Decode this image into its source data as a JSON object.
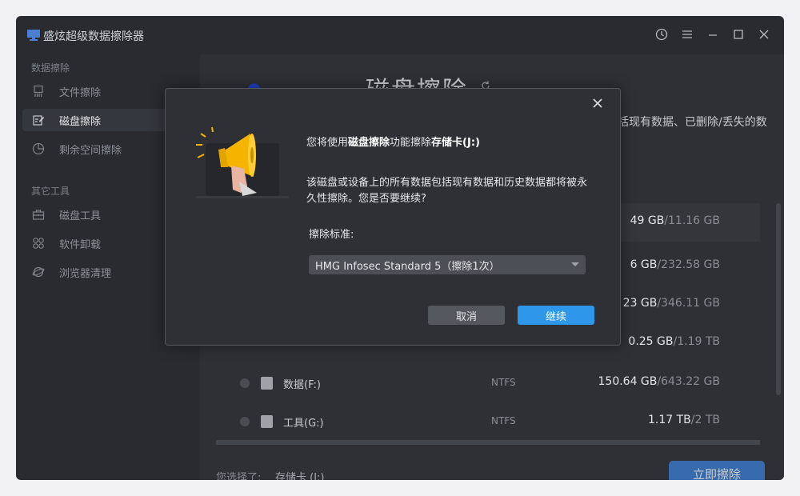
{
  "app": {
    "title": "盛炫超级数据擦除器"
  },
  "sidebar": {
    "section1": "数据擦除",
    "items1": [
      {
        "label": "文件擦除",
        "icon": "file-shred-icon"
      },
      {
        "label": "磁盘擦除",
        "icon": "disk-edit-icon",
        "active": true
      },
      {
        "label": "剩余空间擦除",
        "icon": "pie-chart-icon"
      }
    ],
    "section2": "其它工具",
    "items2": [
      {
        "label": "磁盘工具",
        "icon": "toolbox-icon"
      },
      {
        "label": "软件卸载",
        "icon": "apps-grid-icon"
      },
      {
        "label": "浏览器清理",
        "icon": "browser-icon"
      }
    ]
  },
  "main": {
    "heading": "磁盘擦除",
    "description": "括现有数据、已删除/丢失的数",
    "drives": [
      {
        "name": "",
        "fs": "",
        "used": "49 GB",
        "total": "/11.16 GB",
        "highlight": true
      },
      {
        "name": "",
        "fs": "",
        "used": "6 GB",
        "total": "/232.58 GB"
      },
      {
        "name": "",
        "fs": "",
        "used": "23 GB",
        "total": "/346.11 GB"
      },
      {
        "name": "",
        "fs": "",
        "used": "0.25 GB",
        "total": "/1.19 TB"
      },
      {
        "name": "数据(F:)",
        "fs": "NTFS",
        "used": "150.64 GB",
        "total": "/643.22 GB"
      },
      {
        "name": "工具(G:)",
        "fs": "NTFS",
        "used": "1.17 TB",
        "total": "/2 TB"
      }
    ],
    "footer_label": "您选择了:",
    "footer_value": "存储卡 (J:)",
    "erase_button": "立即擦除"
  },
  "dialog": {
    "line1_prefix": "您将使用",
    "line1_bold1": "磁盘擦除",
    "line1_mid": "功能擦除",
    "line1_bold2": "存储卡(J:)",
    "warning": "该磁盘或设备上的所有数据包括现有数据和历史数据都将被永久性擦除。您是否要继续?",
    "standard_label": "擦除标准:",
    "standard_value": "HMG Infosec Standard 5（擦除1次）",
    "cancel": "取消",
    "continue": "继续"
  },
  "colors": {
    "primary": "#2f97ea",
    "background": "#292b31",
    "dialog": "#2f3036",
    "megaphone": "#f5b400"
  }
}
